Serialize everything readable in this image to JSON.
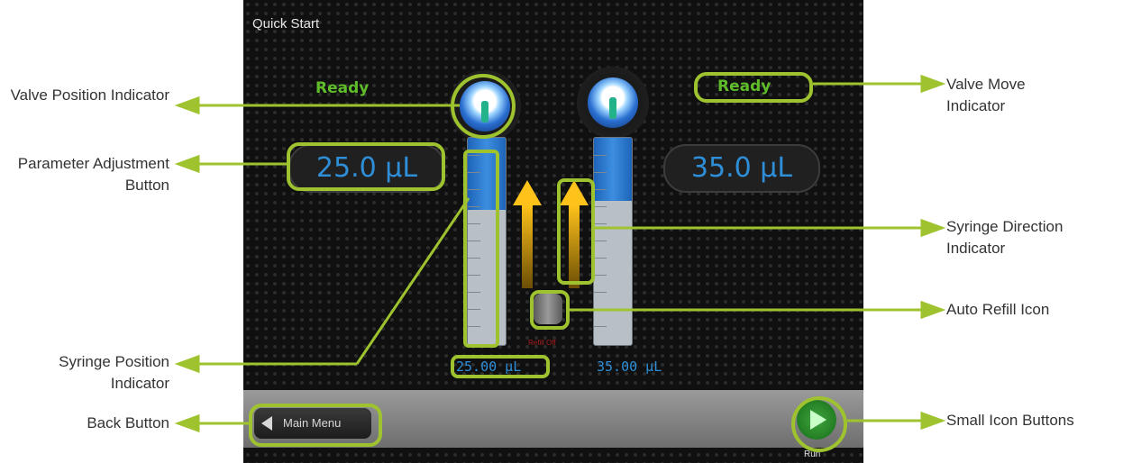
{
  "screen": {
    "title": "Quick Start",
    "left_status": "Ready",
    "right_status": "Ready",
    "left_volume": "25.0 µL",
    "right_volume": "35.0 µL",
    "left_position": "25.00 µL",
    "right_position": "35.00 µL",
    "refill_label": "Refill Off",
    "back_label": "Main Menu",
    "run_label": "Run"
  },
  "callouts": {
    "valve_position": "Valve Position Indicator",
    "parameter_adjustment": "Parameter Adjustment Button",
    "syringe_position": "Syringe Position Indicator",
    "back_button": "Back Button",
    "valve_move": "Valve Move Indicator",
    "syringe_direction": "Syringe Direction Indicator",
    "auto_refill": "Auto Refill Icon",
    "small_icon_buttons": "Small Icon Buttons"
  },
  "colors": {
    "accent": "#9ec32e",
    "status_ready": "#5fbd2a",
    "value_blue": "#2e8fd8"
  }
}
